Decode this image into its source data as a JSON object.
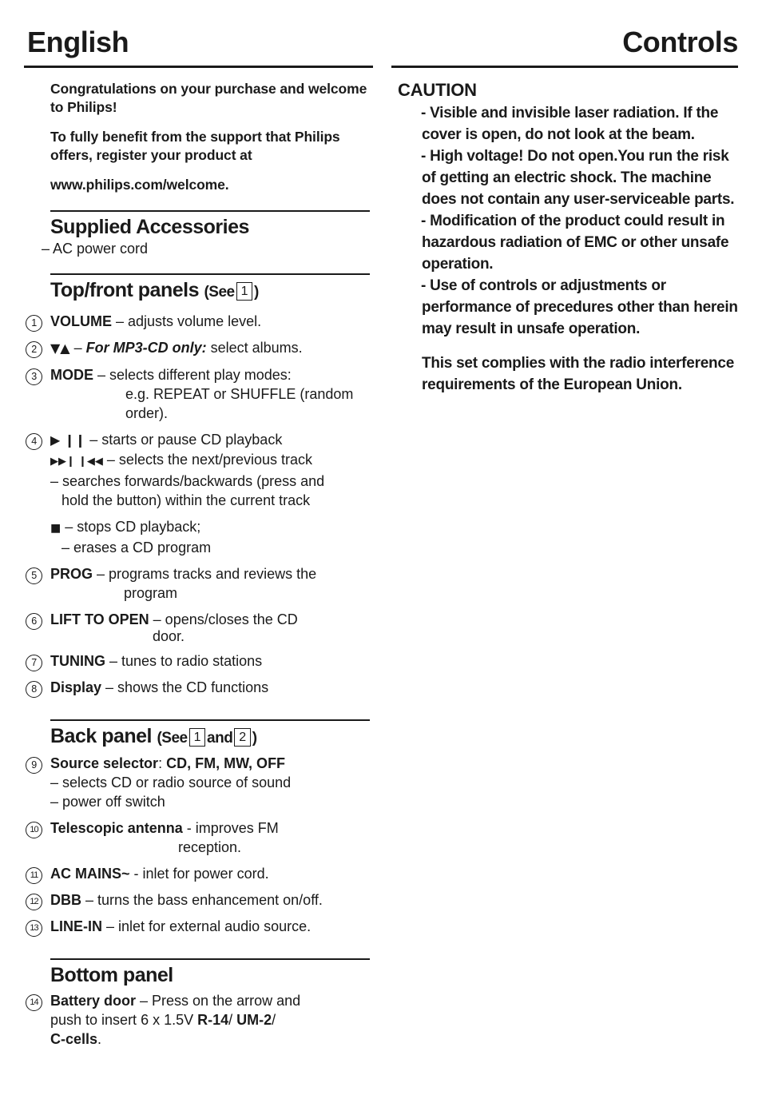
{
  "header": {
    "left_title": "English",
    "right_title": "Controls"
  },
  "left_column": {
    "intro": [
      "Congratulations on your purchase and welcome to Philips!",
      "To fully benefit from the support that Philips offers, register your product at",
      "www.philips.com/welcome."
    ],
    "supplied_accessories": {
      "title": "Supplied Accessories",
      "items": [
        "– AC power cord"
      ]
    },
    "top_front_panels": {
      "title_main": "Top/front panels",
      "title_see": "(See",
      "title_box": "1",
      "title_close": ")",
      "items": [
        {
          "num": "1",
          "label": "VOLUME",
          "text": " – adjusts volume level."
        },
        {
          "num": "2",
          "glyph": "▼▲",
          "em": "For MP3-CD only:",
          "dash": " – ",
          "text": " select albums."
        },
        {
          "num": "3",
          "label": "MODE",
          "text": " – selects different play modes:",
          "cont": [
            "e.g. REPEAT or SHUFFLE (random",
            "order)."
          ]
        },
        {
          "num": "4",
          "glyph": "▶ ❙❙",
          "text": " – starts or pause CD playback",
          "line2_glyph": "▶▶❙ ❙◀◀",
          "line2_text": " – selects the next/previous track",
          "line3": "– searches forwards/backwards (press and",
          "line4": "hold the button) within the current track",
          "line5_glyph": "■",
          "line5_text": " – stops CD playback;",
          "line6": "– erases a CD program"
        },
        {
          "num": "5",
          "label": "PROG",
          "text": " – programs tracks and reviews the",
          "cont": [
            "program"
          ]
        },
        {
          "num": "6",
          "label": "LIFT TO OPEN",
          "text": " – opens/closes the CD",
          "cont": [
            "door."
          ]
        },
        {
          "num": "7",
          "label": "TUNING",
          "text": " – tunes to radio stations"
        },
        {
          "num": "8",
          "label": "Display",
          "text": " – shows the CD functions"
        }
      ]
    },
    "back_panel": {
      "title_main": "Back panel",
      "title_see": "(See",
      "title_box1": "1",
      "title_and": "and",
      "title_box2": "2",
      "title_close": ")",
      "items": [
        {
          "num": "9",
          "label": "Source selector",
          "text": ": ",
          "label2": "CD, FM, MW, OFF",
          "line2": "– selects CD or radio source of sound",
          "line3": "– power off switch"
        },
        {
          "num": "10",
          "label": "Telescopic antenna",
          "text": " - improves FM",
          "cont": [
            "reception."
          ]
        },
        {
          "num": "11",
          "label": "AC MAINS~",
          "text": " - inlet for power cord."
        },
        {
          "num": "12",
          "label": "DBB",
          "text": " – turns the bass enhancement on/off."
        },
        {
          "num": "13",
          "label": "LINE-IN",
          "text": " – inlet for external audio source."
        }
      ]
    },
    "bottom_panel": {
      "title": "Bottom panel",
      "items": [
        {
          "num": "14",
          "label": "Battery door",
          "text": " – Press on the arrow and",
          "line2_pre": "push to insert 6 x 1.5V ",
          "line2_b1": "R-14",
          "line2_mid": "/ ",
          "line2_b2": "UM-2",
          "line2_post": "/",
          "line3_b": "C-cells",
          "line3_post": "."
        }
      ]
    }
  },
  "right_column": {
    "caution_title": "CAUTION",
    "caution_paragraphs": [
      "- Visible and invisible laser radiation. If the cover is open, do not look at the beam.",
      "- High voltage! Do not open.You run the risk of getting an electric shock. The machine does not contain any user-serviceable parts.",
      "- Modification of the product could result in hazardous radiation of EMC or other unsafe operation.",
      "- Use of controls or adjustments or performance of precedures other than herein may result in unsafe operation."
    ],
    "compliance_note": "This set complies with the radio interference requirements of the European Union."
  }
}
